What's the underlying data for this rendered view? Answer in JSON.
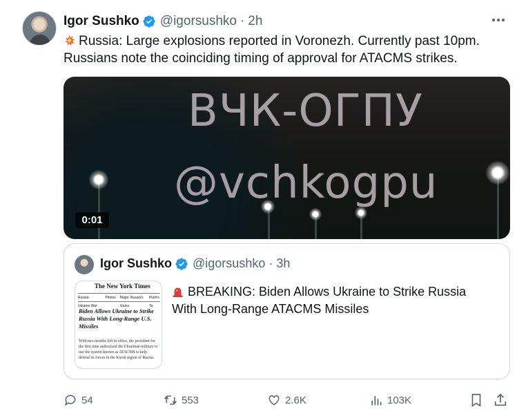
{
  "tweet": {
    "author": {
      "name": "Igor Sushko",
      "handle": "@igorsushko",
      "separator": "·",
      "time": "2h"
    },
    "text": "Russia: Large explosions reported in Voronezh. Currently past 10pm.\nRussians note the coinciding timing of approval for ATACMS strikes.",
    "text_prefix_icon": "collision-icon",
    "media": {
      "watermark_line1": "ВЧК-ОГПУ",
      "watermark_line2": "@vchkogpu",
      "duration": "0:01"
    },
    "quote": {
      "author": {
        "name": "Igor Sushko",
        "handle": "@igorsushko",
        "separator": "·",
        "time": "3h"
      },
      "text_prefix_icon": "police-light-icon",
      "text": "BREAKING: Biden Allows Ukraine to Strike Russia\nWith Long-Range ATACMS Missiles",
      "thumbnail": {
        "masthead": "The New York Times",
        "nav": [
          "Russia-Ukraine War",
          "Photos",
          "Maps: Russia's Gains",
          "Putin's Ta"
        ],
        "headline": "Biden Allows Ukraine to Strike Russia With Long-Range U.S. Missiles",
        "body": "With two months left in office, the president for the first time authorized the Ukrainian military to use the system known as ATACMS to help defend its forces in the Kursk region of Russia."
      }
    },
    "actions": {
      "replies": "54",
      "reposts": "553",
      "likes": "2.6K",
      "views": "103K"
    },
    "colors": {
      "verified_badge": "#1d9bf0",
      "secondary_text": "#536471",
      "primary_text": "#0f1419",
      "border": "#cfd9de"
    }
  }
}
